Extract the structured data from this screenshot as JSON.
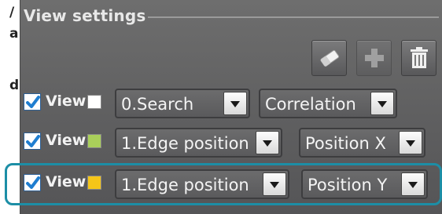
{
  "left_edge": {
    "chars": [
      "/",
      "a",
      "d"
    ]
  },
  "panel": {
    "title": "View settings"
  },
  "toolbar": {
    "buttons": [
      {
        "icon": "eraser-icon",
        "enabled": true
      },
      {
        "icon": "plus-icon",
        "enabled": false
      },
      {
        "icon": "trash-icon",
        "enabled": true
      }
    ]
  },
  "rows": [
    {
      "checked": true,
      "label": "View",
      "swatch_color": "#ffffff",
      "source": "0.Search",
      "measurement": "Correlation",
      "selected": false
    },
    {
      "checked": true,
      "label": "View",
      "swatch_color": "#a9cf5a",
      "source": "1.Edge position",
      "measurement": "Position X",
      "selected": false
    },
    {
      "checked": true,
      "label": "View",
      "swatch_color": "#f5c518",
      "source": "1.Edge position",
      "measurement": "Position Y",
      "selected": true
    }
  ],
  "colors": {
    "highlight": "#1c8ea6",
    "checkbox_check": "#1f7ed0",
    "panel_bg": "#636364"
  }
}
